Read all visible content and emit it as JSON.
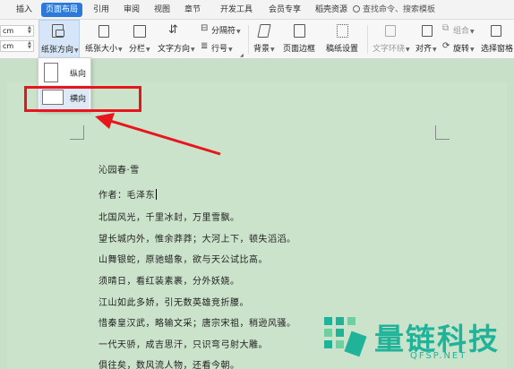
{
  "tabs": [
    "插入",
    "页面布局",
    "引用",
    "审阅",
    "视图",
    "章节",
    "开发工具",
    "会员专享",
    "稻壳资源"
  ],
  "active_tab": "页面布局",
  "search_label": "查找命令、搜索模板",
  "ribbon": {
    "margin_top_unit": "cm",
    "margin_bottom_unit": "cm",
    "orientation": "纸张方向",
    "paper_size": "纸张大小",
    "columns": "分栏",
    "text_direction": "文字方向",
    "separator": "分隔符",
    "line_number": "行号",
    "background": "背景",
    "page_border": "页面边框",
    "manuscript": "稿纸设置",
    "text_wrap": "文字环绕",
    "align": "对齐",
    "group": "组合",
    "rotate": "旋转",
    "selection_pane": "选择窗格"
  },
  "orientation_menu": {
    "portrait": "纵向",
    "landscape": "横向"
  },
  "document": {
    "title": "沁园春·雪",
    "author": "作者：毛泽东",
    "lines": [
      "北国风光，千里冰封，万里雪飘。",
      "望长城内外，惟余莽莽；大河上下，顿失滔滔。",
      "山舞银蛇，原驰蜡象，欲与天公试比高。",
      "须晴日，看红装素裹，分外妖娆。",
      "江山如此多娇，引无数英雄竞折腰。",
      "惜秦皇汉武，略输文采；唐宗宋祖，稍逊风骚。",
      "一代天骄，成吉思汗，只识弯弓射大雕。",
      "俱往矣，数风流人物，还看今朝。"
    ]
  },
  "watermark": {
    "title": "量链科技",
    "url": "QFSP.NET"
  },
  "colors": {
    "accent": "#2b79d8",
    "highlight": "#e8161c",
    "page_bg": "#c8dfc8",
    "watermark": "#1fb39a"
  }
}
